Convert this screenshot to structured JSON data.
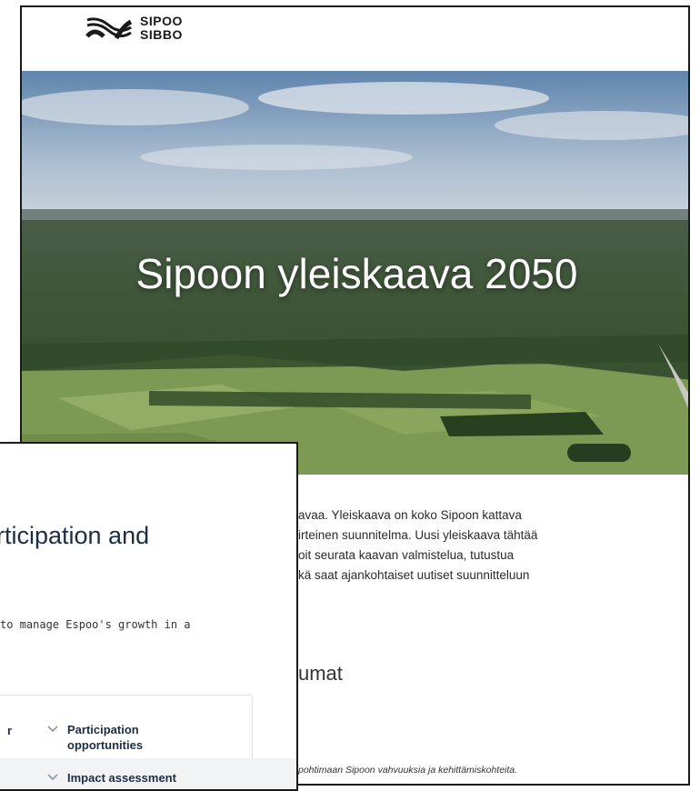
{
  "sipoo": {
    "logo": {
      "line1": "SIPOO",
      "line2": "SIBBO",
      "icon": "sipoo-wave-logo"
    },
    "hero_title": "Sipoon yleiskaava 2050",
    "intro_lines": [
      "avaa. Yleiskaava on koko Sipoon kattava",
      "irteinen suunnitelma. Uusi yleiskaava tähtää",
      "oit seurata kaavan valmistelua, tutustua",
      "kä saat ajankohtaiset uutiset suunnitteluun"
    ],
    "subheading": "umat",
    "caption": "pohtimaan Sipoon vahvuuksia ja kehittämiskohteita."
  },
  "espoo": {
    "title_line1": "rticipation and",
    "subtitle": " to manage Espoo's growth in a",
    "nav_fragment": "r",
    "nav_items": [
      {
        "label_lines": [
          "Participation",
          "opportunities"
        ],
        "icon": "chevron-down-icon"
      },
      {
        "label_lines": [
          "Impact assessment"
        ],
        "icon": "chevron-down-icon"
      }
    ]
  },
  "colors": {
    "navy": "#1d2d44",
    "border": "#1a1a1a"
  }
}
